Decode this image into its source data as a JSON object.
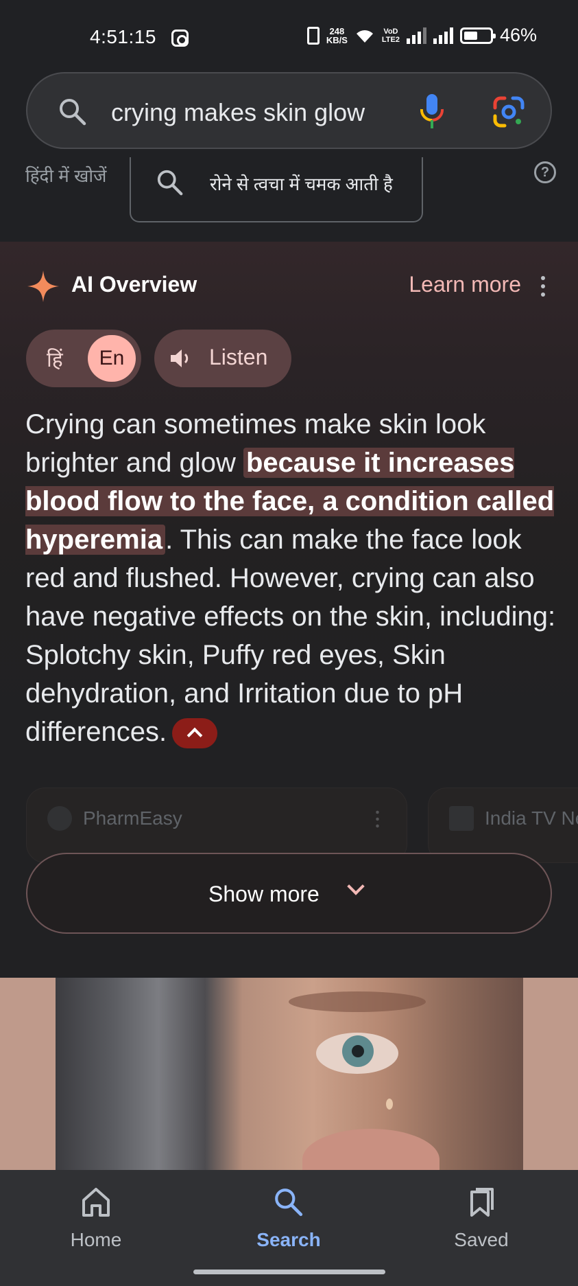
{
  "status_bar": {
    "time": "4:51:15",
    "net_speed_value": "248",
    "net_speed_unit": "KB/S",
    "volte_top": "VoD",
    "volte_bottom": "LTE2",
    "battery_percent": "46%",
    "battery_level": 0.46
  },
  "search": {
    "query": "crying makes skin glow"
  },
  "hindi_search": {
    "label": "हिंदी में खोजें",
    "query": "रोने से त्वचा में चमक आती है",
    "help_glyph": "?"
  },
  "ai_overview": {
    "title": "AI Overview",
    "learn_more": "Learn more",
    "lang_hi": "हिं",
    "lang_en": "En",
    "listen": "Listen",
    "text_before": "Crying can sometimes make skin look brighter and glow ",
    "text_highlight": "because it increases blood flow to the face, a condition called hyperemia",
    "text_after": ". This can make the face look red and flushed. However, crying can also have negative effects on the skin, including: Splotchy skin, Puffy red eyes, Skin dehydration, and Irritation due to pH differences.",
    "sources": [
      {
        "name": "PharmEasy"
      },
      {
        "name": "India TV Ne"
      }
    ],
    "show_more": "Show more"
  },
  "bottom_nav": {
    "items": [
      {
        "label": "Home",
        "icon": "home-icon"
      },
      {
        "label": "Search",
        "icon": "search-icon"
      },
      {
        "label": "Saved",
        "icon": "bookmark-icon"
      }
    ],
    "active": "Search"
  },
  "colors": {
    "accent_blue": "#8ab4f8",
    "ai_pink": "#f2b8b5",
    "highlight_bg": "#5b3b3b",
    "chip_bg": "#5b4143",
    "collapse_red": "#8c1d18"
  }
}
